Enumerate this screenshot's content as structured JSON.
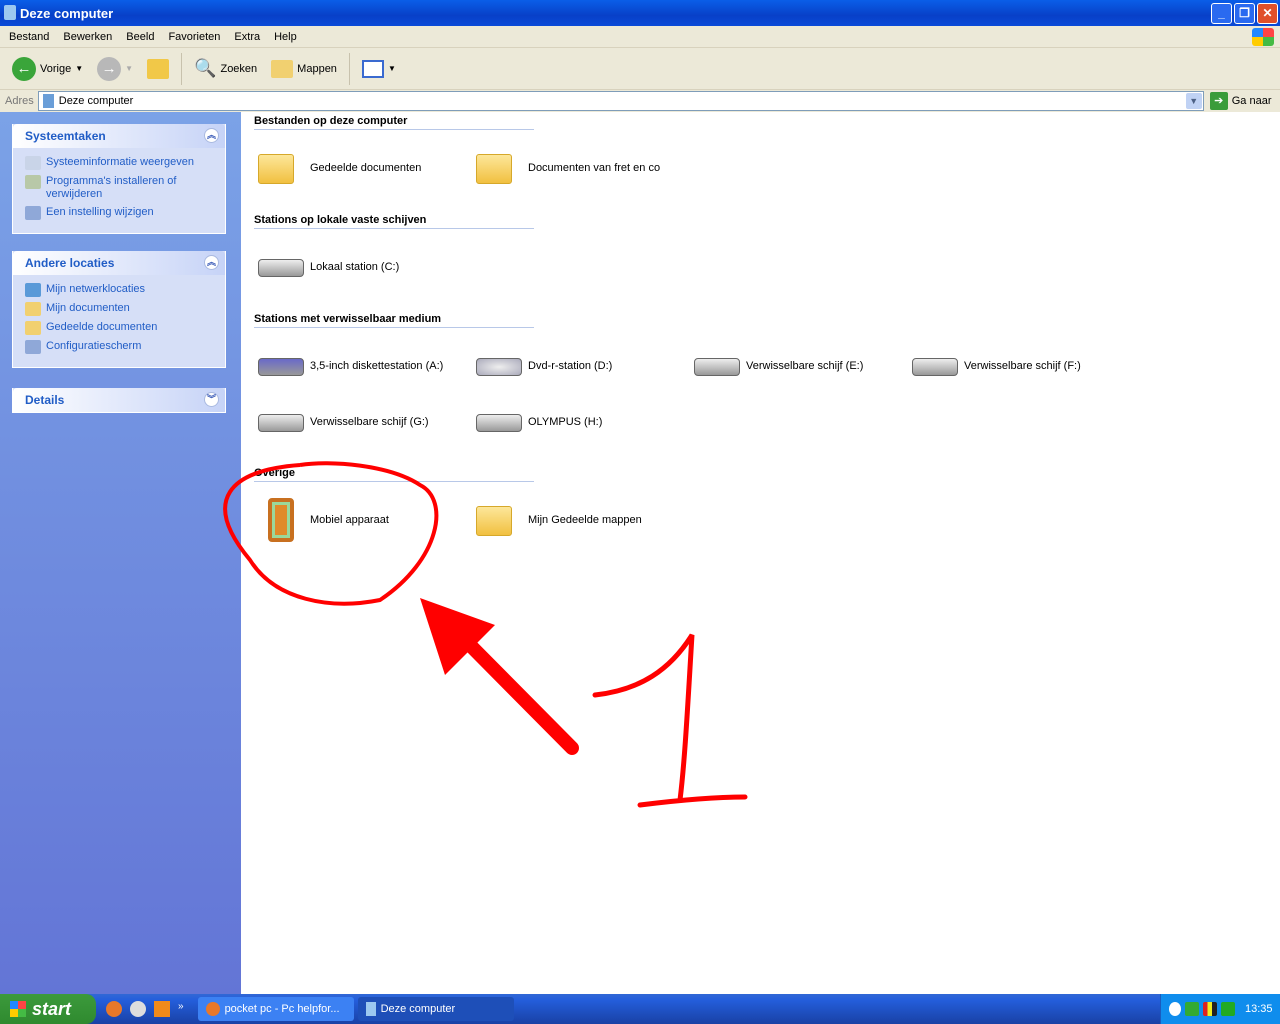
{
  "window": {
    "title": "Deze computer"
  },
  "menu": [
    "Bestand",
    "Bewerken",
    "Beeld",
    "Favorieten",
    "Extra",
    "Help"
  ],
  "toolbar": {
    "back": "Vorige",
    "search": "Zoeken",
    "folders": "Mappen"
  },
  "address": {
    "label": "Adres",
    "value": "Deze computer",
    "go": "Ga naar"
  },
  "sidebar": {
    "system_tasks": {
      "title": "Systeemtaken",
      "items": [
        "Systeeminformatie weergeven",
        "Programma's installeren of verwijderen",
        "Een instelling wijzigen"
      ]
    },
    "other_places": {
      "title": "Andere locaties",
      "items": [
        "Mijn netwerklocaties",
        "Mijn documenten",
        "Gedeelde documenten",
        "Configuratiescherm"
      ]
    },
    "details": {
      "title": "Details"
    }
  },
  "groups": [
    {
      "title": "Bestanden op deze computer",
      "items": [
        "Gedeelde documenten",
        "Documenten van fret en co"
      ]
    },
    {
      "title": "Stations op lokale vaste schijven",
      "items": [
        "Lokaal station (C:)"
      ]
    },
    {
      "title": "Stations met verwisselbaar medium",
      "items": [
        "3,5-inch diskettestation (A:)",
        "Dvd-r-station (D:)",
        "Verwisselbare schijf (E:)",
        "Verwisselbare schijf (F:)",
        "Verwisselbare schijf (G:)",
        "OLYMPUS (H:)"
      ]
    },
    {
      "title": "Overige",
      "items": [
        "Mobiel apparaat",
        "Mijn Gedeelde mappen"
      ]
    }
  ],
  "annotation": {
    "label": "1",
    "color": "#ff0000"
  },
  "taskbar": {
    "start": "start",
    "tasks": [
      "pocket pc - Pc helpfor...",
      "Deze computer"
    ],
    "clock": "13:35"
  }
}
